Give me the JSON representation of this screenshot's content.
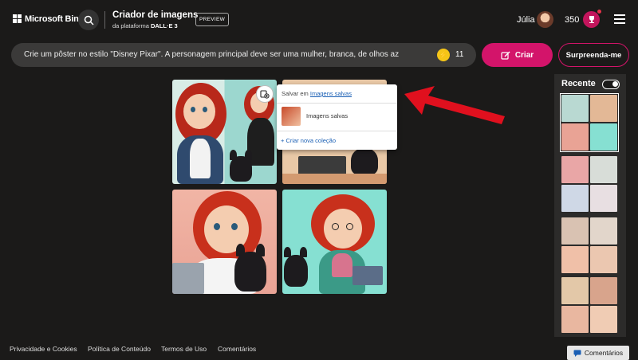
{
  "header": {
    "brand": "Microsoft Bing",
    "app_title": "Criador de imagens",
    "app_subtitle_prefix": "da plataforma ",
    "app_subtitle_bold": "DALL·E 3",
    "preview_badge": "PREVIEW",
    "user_name": "Júlia",
    "rewards_points": "350"
  },
  "prompt": {
    "text": "Crie um pôster no estilo \"Disney Pixar\". A personagem principal deve ser uma mulher, branca, de olhos az",
    "boosts": "11",
    "create_label": "Criar",
    "surprise_label": "Surpreenda-me"
  },
  "save_menu": {
    "header_prefix": "Salvar em",
    "header_link": "Imagens salvas",
    "collection": "Imagens salvas",
    "new_collection": "+ Criar nova coleção"
  },
  "recent": {
    "label": "Recente"
  },
  "footer": {
    "privacy": "Privacidade e Cookies",
    "content_policy": "Política de Conteúdo",
    "terms": "Termos de Uso",
    "comments": "Comentários",
    "feedback": "Comentários"
  },
  "colors": {
    "accent": "#d3146a",
    "background": "#1b1a19",
    "arrow": "#e0101e"
  }
}
